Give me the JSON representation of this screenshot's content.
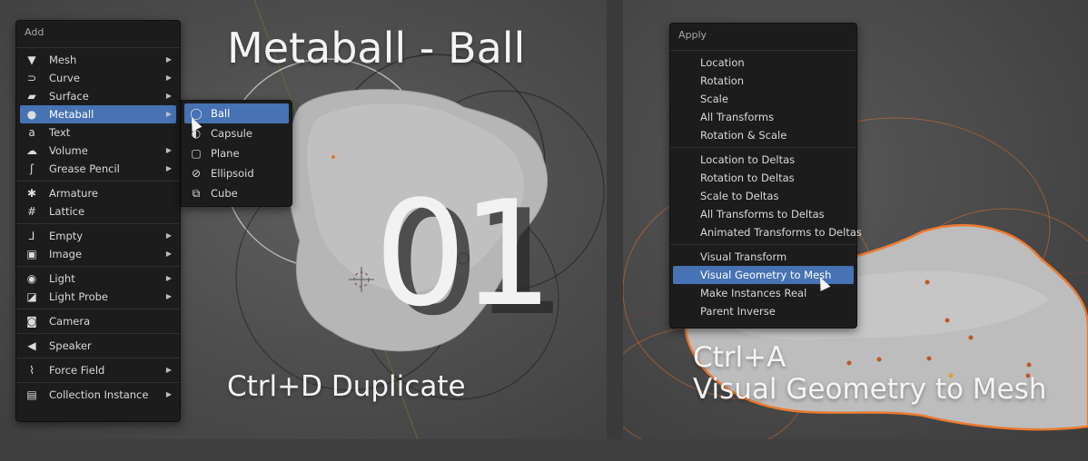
{
  "add_menu": {
    "title": "Add",
    "groups": [
      [
        {
          "label": "Mesh",
          "icon": "mesh-icon",
          "glyph": "▼",
          "submenu": true
        },
        {
          "label": "Curve",
          "icon": "curve-icon",
          "glyph": "⊃",
          "submenu": true
        },
        {
          "label": "Surface",
          "icon": "surface-icon",
          "glyph": "▰",
          "submenu": true
        },
        {
          "label": "Metaball",
          "icon": "metaball-icon",
          "glyph": "●",
          "submenu": true,
          "highlighted": true
        },
        {
          "label": "Text",
          "icon": "text-icon",
          "glyph": "a",
          "submenu": false
        },
        {
          "label": "Volume",
          "icon": "volume-icon",
          "glyph": "☁",
          "submenu": true
        },
        {
          "label": "Grease Pencil",
          "icon": "grease-pencil-icon",
          "glyph": "ʃ",
          "submenu": true
        }
      ],
      [
        {
          "label": "Armature",
          "icon": "armature-icon",
          "glyph": "✱",
          "submenu": false
        },
        {
          "label": "Lattice",
          "icon": "lattice-icon",
          "glyph": "#",
          "submenu": false
        }
      ],
      [
        {
          "label": "Empty",
          "icon": "empty-icon",
          "glyph": "⅃",
          "submenu": true
        },
        {
          "label": "Image",
          "icon": "image-icon",
          "glyph": "▣",
          "submenu": true
        }
      ],
      [
        {
          "label": "Light",
          "icon": "light-icon",
          "glyph": "◉",
          "submenu": true
        },
        {
          "label": "Light Probe",
          "icon": "light-probe-icon",
          "glyph": "◪",
          "submenu": true
        }
      ],
      [
        {
          "label": "Camera",
          "icon": "camera-icon",
          "glyph": "◙",
          "submenu": false
        }
      ],
      [
        {
          "label": "Speaker",
          "icon": "speaker-icon",
          "glyph": "◀",
          "submenu": false
        }
      ],
      [
        {
          "label": "Force Field",
          "icon": "force-field-icon",
          "glyph": "⌇",
          "submenu": true
        }
      ],
      [
        {
          "label": "Collection Instance",
          "icon": "collection-instance-icon",
          "glyph": "▤",
          "submenu": true
        }
      ]
    ]
  },
  "metaball_submenu": {
    "items": [
      {
        "label": "Ball",
        "icon": "ball-icon",
        "glyph": "◯",
        "highlighted": true
      },
      {
        "label": "Capsule",
        "icon": "capsule-icon",
        "glyph": "◐"
      },
      {
        "label": "Plane",
        "icon": "plane-icon",
        "glyph": "▢"
      },
      {
        "label": "Ellipsoid",
        "icon": "ellipsoid-icon",
        "glyph": "⊘"
      },
      {
        "label": "Cube",
        "icon": "cube-icon",
        "glyph": "⧉"
      }
    ]
  },
  "apply_menu": {
    "title": "Apply",
    "groups": [
      [
        {
          "label": "Location"
        },
        {
          "label": "Rotation"
        },
        {
          "label": "Scale"
        },
        {
          "label": "All Transforms"
        },
        {
          "label": "Rotation & Scale"
        }
      ],
      [
        {
          "label": "Location to Deltas"
        },
        {
          "label": "Rotation to Deltas"
        },
        {
          "label": "Scale to Deltas"
        },
        {
          "label": "All Transforms to Deltas"
        },
        {
          "label": "Animated Transforms to Deltas"
        }
      ],
      [
        {
          "label": "Visual Transform"
        },
        {
          "label": "Visual Geometry to Mesh",
          "highlighted": true
        },
        {
          "label": "Make Instances Real"
        },
        {
          "label": "Parent Inverse"
        }
      ]
    ]
  },
  "overlay": {
    "title": "Metaball - Ball",
    "number": "01",
    "duplicate_hint": "Ctrl+D Duplicate",
    "apply_shortcut": "Ctrl+A",
    "apply_action": "Visual Geometry to Mesh"
  },
  "colors": {
    "highlight": "#4772b3",
    "menu_bg": "#1c1c1c",
    "selection_outline": "#e8702a"
  }
}
